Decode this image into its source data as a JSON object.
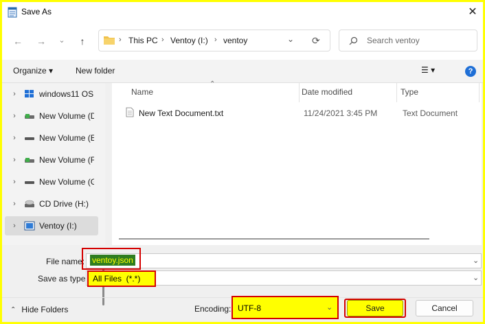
{
  "window": {
    "title": "Save As",
    "close_glyph": "✕"
  },
  "nav_buttons": {
    "back": "←",
    "forward": "→",
    "recent": "⌄",
    "up": "↑"
  },
  "address": {
    "segments": [
      "This PC",
      "Ventoy (I:)",
      "ventoy"
    ],
    "separator": "›",
    "dropdown": "⌄",
    "refresh": "⟳"
  },
  "search": {
    "placeholder": "Search ventoy"
  },
  "commandbar": {
    "organize": "Organize ▾",
    "new_folder": "New folder",
    "view_glyph": "☰ ▾",
    "help": "?"
  },
  "nav_pane": {
    "items": [
      {
        "label": "windows11 OS",
        "icon": "windows-drive-icon",
        "selected": false
      },
      {
        "label": "New Volume (D:)",
        "icon": "volume-icon",
        "selected": false
      },
      {
        "label": "New Volume (E:)",
        "icon": "volume-icon",
        "selected": false
      },
      {
        "label": "New Volume (F:)",
        "icon": "volume-icon",
        "selected": false
      },
      {
        "label": "New Volume (G:)",
        "icon": "volume-icon",
        "selected": false
      },
      {
        "label": "CD Drive (H:)",
        "icon": "cd-drive-icon",
        "selected": false
      },
      {
        "label": "Ventoy (I:)",
        "icon": "usb-drive-icon",
        "selected": true
      }
    ],
    "chevron": "›"
  },
  "file_list": {
    "columns": [
      "Name",
      "Date modified",
      "Type"
    ],
    "sort_glyph": "⌃",
    "rows": [
      {
        "name": "New Text Document.txt",
        "date": "11/24/2021 3:45 PM",
        "type": "Text Document"
      }
    ]
  },
  "form": {
    "file_name_label": "File name:",
    "file_name_value": "ventoy.json",
    "save_as_type_label": "Save as type:",
    "save_as_type_value": "All Files  (*.*)",
    "encoding_label": "Encoding:",
    "encoding_value": "UTF-8",
    "chevron": "⌄"
  },
  "footer": {
    "hide_folders": "Hide Folders",
    "hide_glyph": "⌃",
    "save": "Save",
    "cancel": "Cancel"
  },
  "colors": {
    "highlight_yellow": "#ffff00",
    "highlight_red": "#d40000",
    "help_blue": "#1f6fd6"
  }
}
